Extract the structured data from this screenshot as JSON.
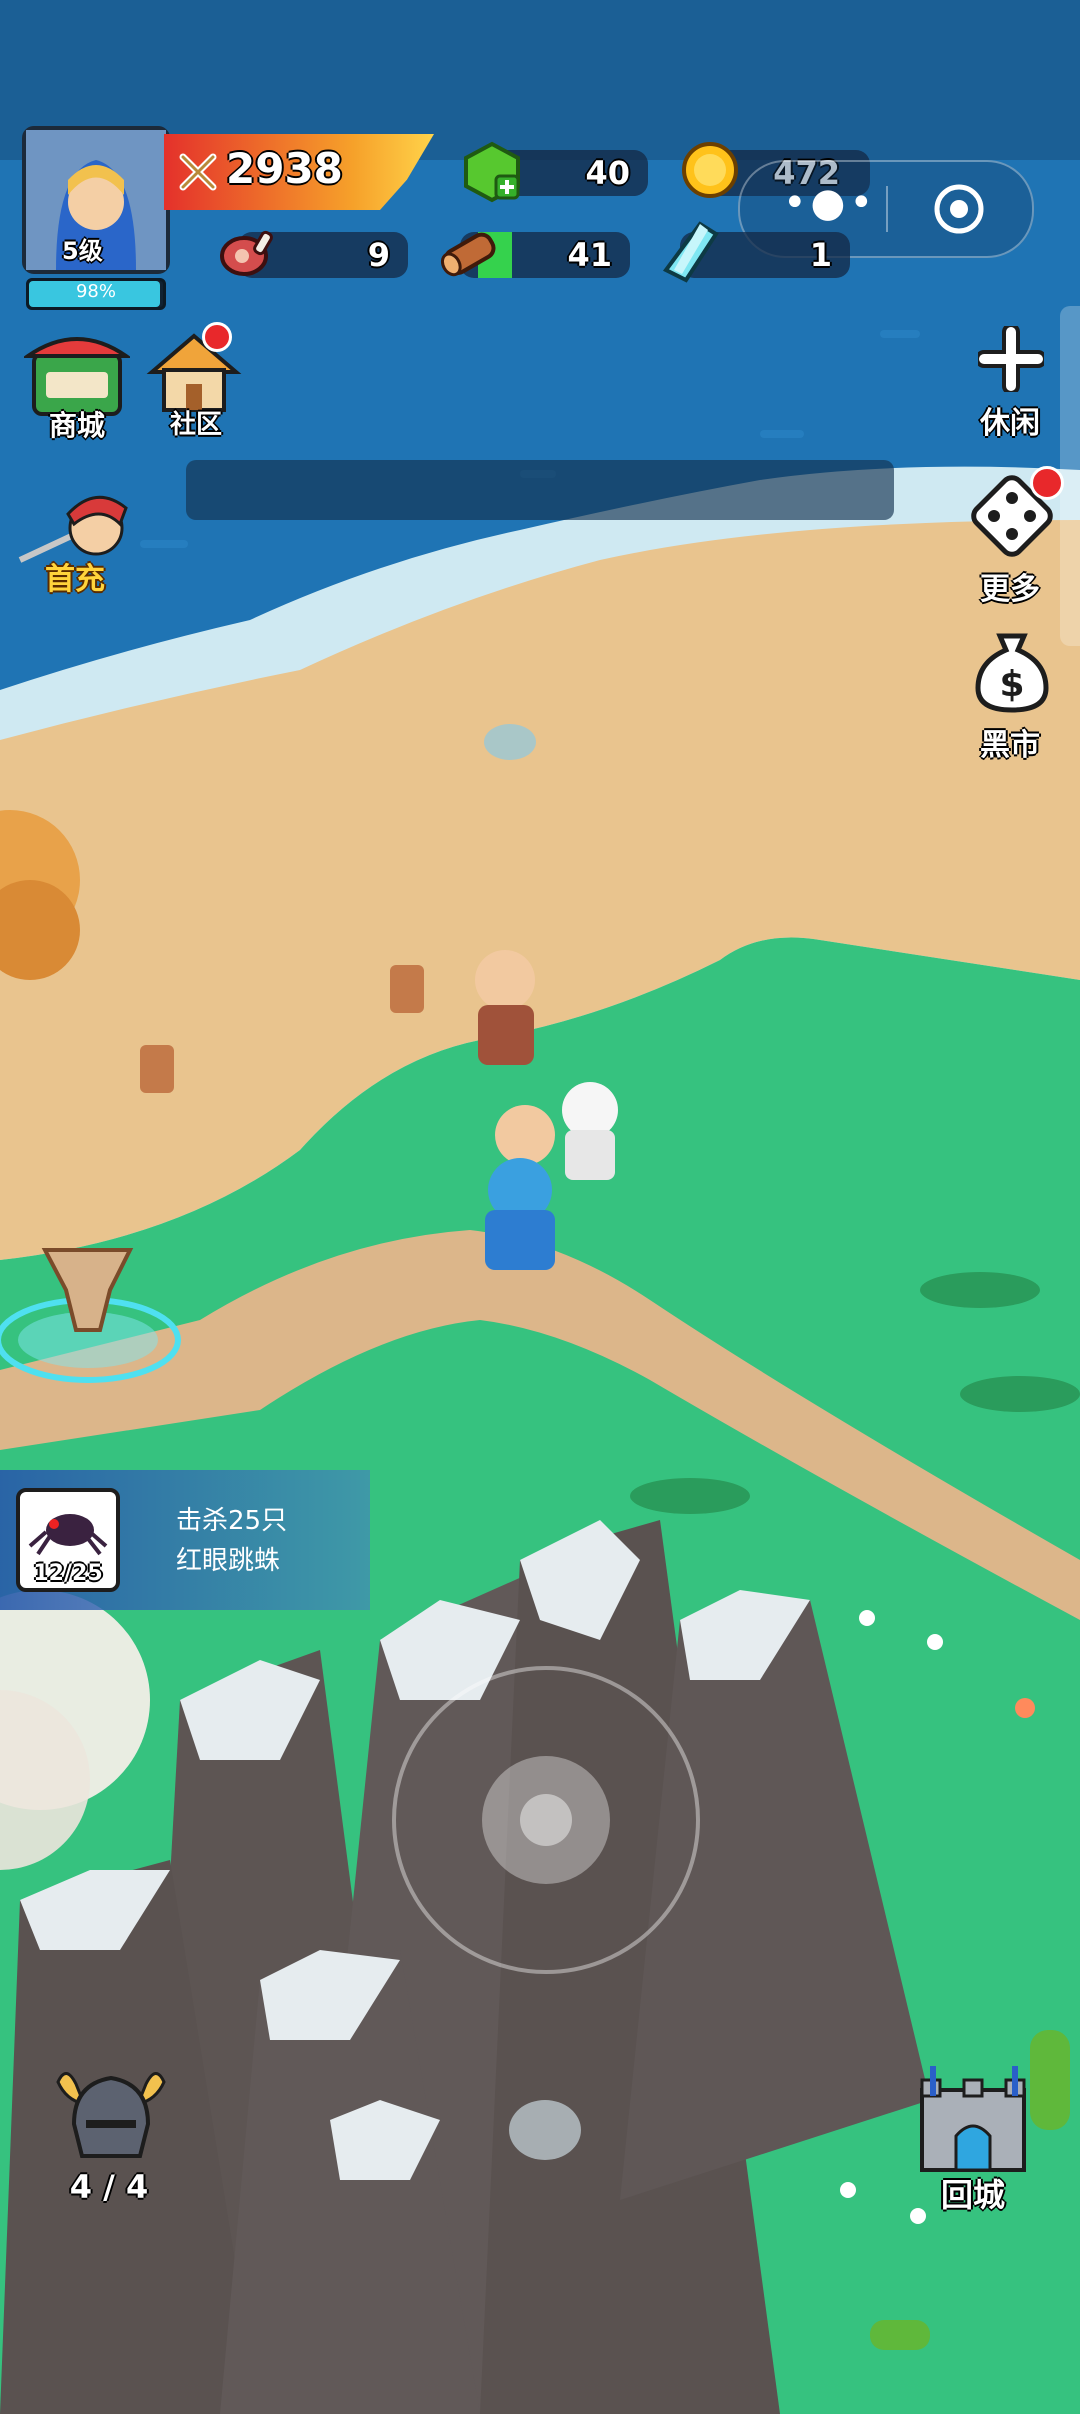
{
  "player": {
    "level": "5级",
    "exp_percent_text": "98%",
    "exp_fraction": 0.98,
    "power": "2938"
  },
  "resources": {
    "gems": "40",
    "coins": "472",
    "meat": "9",
    "wood": "41",
    "crystal": "1"
  },
  "left_menu": {
    "shop": "商城",
    "community": "社区",
    "first_recharge": "首充"
  },
  "right_menu": {
    "leisure": "休闲",
    "more": "更多",
    "black_market": "黑市"
  },
  "quest": {
    "progress": "12/25",
    "line1": "击杀25只",
    "line2": "红眼跳蛛"
  },
  "helmet": {
    "count": "4 / 4"
  },
  "return_city": {
    "label": "回城"
  },
  "colors": {
    "sea": "#1d6fae",
    "sand": "#e9c48e",
    "grass": "#34c07e",
    "exp_bar": "#39c6e0",
    "power_banner": "#f0502a"
  },
  "icons": [
    "crossed-swords-icon",
    "gem-icon",
    "coin-icon",
    "meat-icon",
    "wood-icon",
    "crystal-icon",
    "shop-icon",
    "house-icon",
    "plus-icon",
    "dice-icon",
    "money-bag-icon",
    "spider-icon",
    "helmet-icon",
    "castle-icon",
    "joystick-icon"
  ]
}
